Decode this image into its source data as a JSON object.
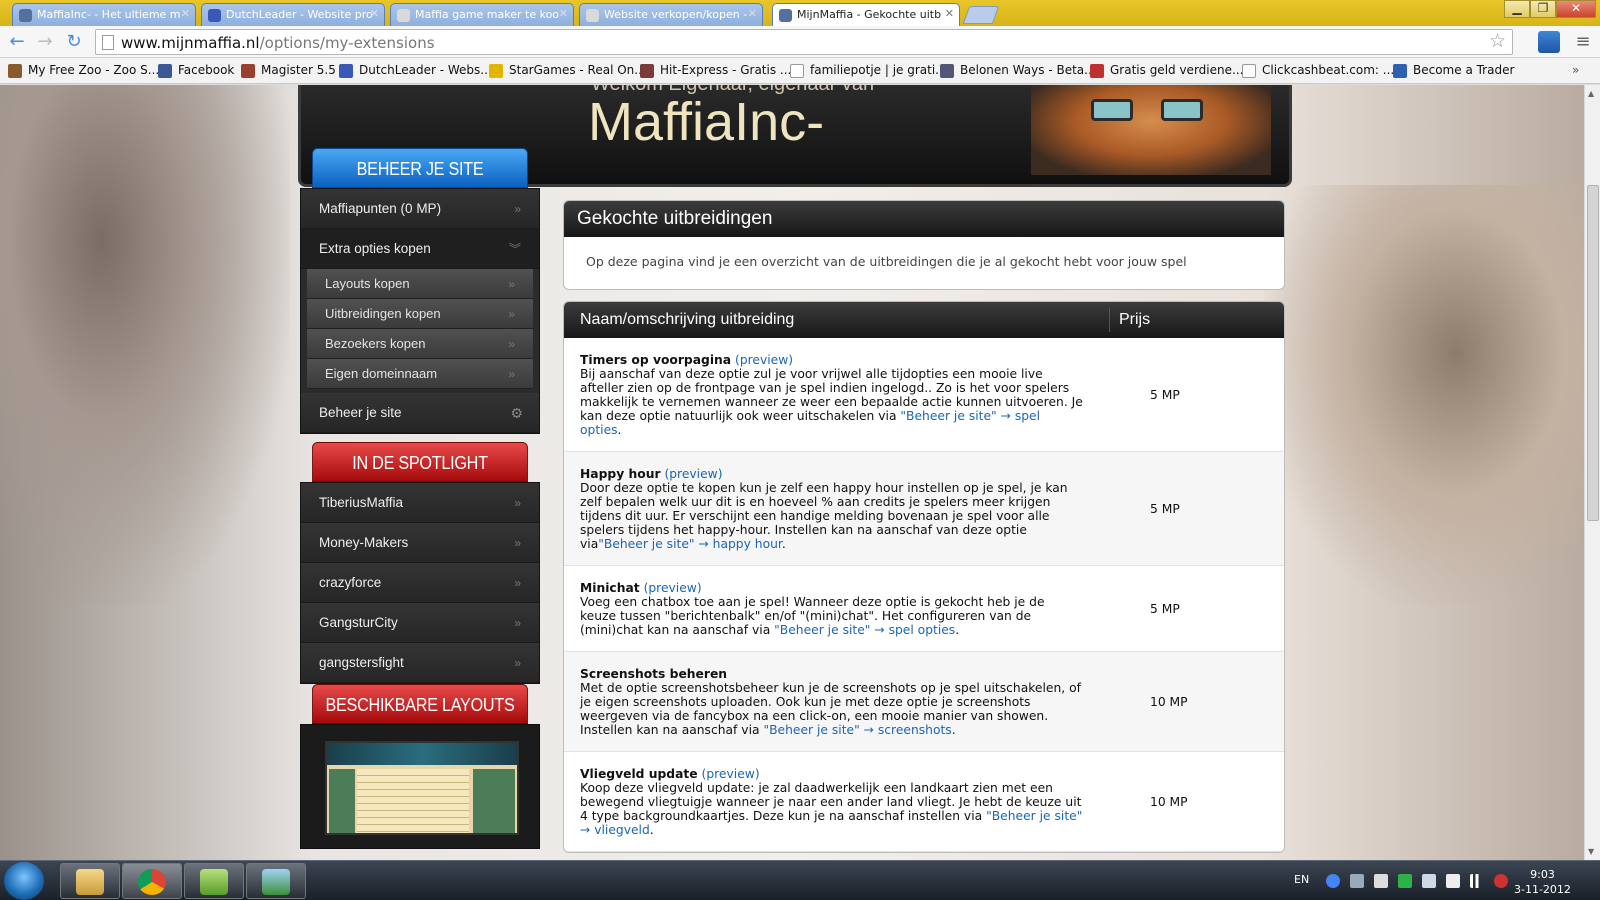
{
  "browser": {
    "tabs": [
      {
        "title": "MaffiaInc- - Het ultieme m"
      },
      {
        "title": "DutchLeader - Website pro"
      },
      {
        "title": "Maffia game maker te koo"
      },
      {
        "title": "Website verkopen/kopen -"
      },
      {
        "title": "MijnMaffia - Gekochte uitb"
      }
    ],
    "url_host": "www.mijnmaffia.nl",
    "url_path": "/options/my-extensions",
    "bookmarks": [
      {
        "label": "My Free Zoo - Zoo S...",
        "color": "#8b5a2b"
      },
      {
        "label": "Facebook",
        "color": "#3b5998"
      },
      {
        "label": "Magister 5.5",
        "color": "#9b3f2e"
      },
      {
        "label": "DutchLeader - Webs...",
        "color": "#3a58b6"
      },
      {
        "label": "StarGames - Real On...",
        "color": "#e3b400"
      },
      {
        "label": "Hit-Express - Gratis ...",
        "color": "#7a3b3b"
      },
      {
        "label": "familiepotje | je grati...",
        "color": "#ffffff"
      },
      {
        "label": "Belonen Ways - Beta...",
        "color": "#555577"
      },
      {
        "label": "Gratis geld verdiene...",
        "color": "#c03030"
      },
      {
        "label": "Clickcashbeat.com: ...",
        "color": "#ffffff"
      },
      {
        "label": "Become a Trader",
        "color": "#2f5fb0"
      }
    ]
  },
  "banner": {
    "welcome": "Welkom Eigenaar, eigenaar van",
    "site_name": "MaffiaInc-"
  },
  "sidebar": {
    "manage_title": "BEHEER JE SITE",
    "manage_items": [
      {
        "label": "Maffiapunten (0 MP)"
      },
      {
        "label": "Extra opties kopen"
      }
    ],
    "sub_items": [
      {
        "label": "Layouts kopen"
      },
      {
        "label": "Uitbreidingen kopen"
      },
      {
        "label": "Bezoekers kopen"
      },
      {
        "label": "Eigen domeinnaam"
      }
    ],
    "manage_last": "Beheer je site",
    "spotlight_title": "IN DE SPOTLIGHT",
    "spotlight_items": [
      {
        "label": "TiberiusMaffia"
      },
      {
        "label": "Money-Makers"
      },
      {
        "label": "crazyforce"
      },
      {
        "label": "GangsturCity"
      },
      {
        "label": "gangstersfight"
      }
    ],
    "layouts_title": "BESCHIKBARE LAYOUTS"
  },
  "main": {
    "title": "Gekochte uitbreidingen",
    "intro": "Op deze pagina vind je een overzicht van de uitbreidingen die je al gekocht hebt voor jouw spel",
    "col_name": "Naam/omschrijving uitbreiding",
    "col_price": "Prijs",
    "rows": [
      {
        "name": "Timers op voorpagina",
        "preview": "(preview)",
        "desc": "Bij aanschaf van deze optie zul je voor vrijwel alle tijdopties een mooie live afteller zien op de frontpage van je spel indien ingelogd.. Zo is het voor spelers makkelijk te vernemen wanneer ze weer een bepaalde actie kunnen uitvoeren. Je kan deze optie natuurlijk ook weer uitschakelen via ",
        "link": "\"Beheer je site\" → spel opties",
        "end": ".",
        "price": "5 MP"
      },
      {
        "name": "Happy hour",
        "preview": "(preview)",
        "desc": "Door deze optie te kopen kun je zelf een happy hour instellen op je spel, je kan zelf bepalen welk uur dit is en hoeveel % aan credits je spelers meer krijgen tijdens dit uur. Er verschijnt een handige melding bovenaan je spel voor alle spelers tijdens het happy-hour. Instellen kan na aanschaf van deze optie via",
        "link": "\"Beheer je site\" → happy hour",
        "end": ".",
        "price": "5 MP"
      },
      {
        "name": "Minichat",
        "preview": "(preview)",
        "desc": "Voeg een chatbox toe aan je spel! Wanneer deze optie is gekocht heb je de keuze tussen \"berichtenbalk\" en/of \"(mini)chat\". Het configureren van de (mini)chat kan na aanschaf via ",
        "link": "\"Beheer je site\" → spel opties",
        "end": ".",
        "price": "5 MP"
      },
      {
        "name": "Screenshots beheren",
        "preview": "",
        "desc": "Met de optie screenshotsbeheer kun je de screenshots op je spel uitschakelen, of je eigen screenshots uploaden. Ook kun je met deze optie je screenshots weergeven via de fancybox na een click-on, een mooie manier van showen. Instellen kan na aanschaf via ",
        "link": "\"Beheer je site\" → screenshots",
        "end": ".",
        "price": "10 MP"
      },
      {
        "name": "Vliegveld update",
        "preview": "(preview)",
        "desc": "Koop deze vliegveld update: je zal daadwerkelijk een landkaart zien met een bewegend vliegtuigje wanneer je naar een ander land vliegt. Je hebt de keuze uit 4 type backgroundkaartjes. Deze kun je na aanschaf instellen via ",
        "link": "\"Beheer je site\" → vliegveld",
        "end": ".",
        "price": "10 MP"
      }
    ]
  },
  "taskbar": {
    "lang": "EN",
    "time": "9:03",
    "date": "3-11-2012"
  }
}
